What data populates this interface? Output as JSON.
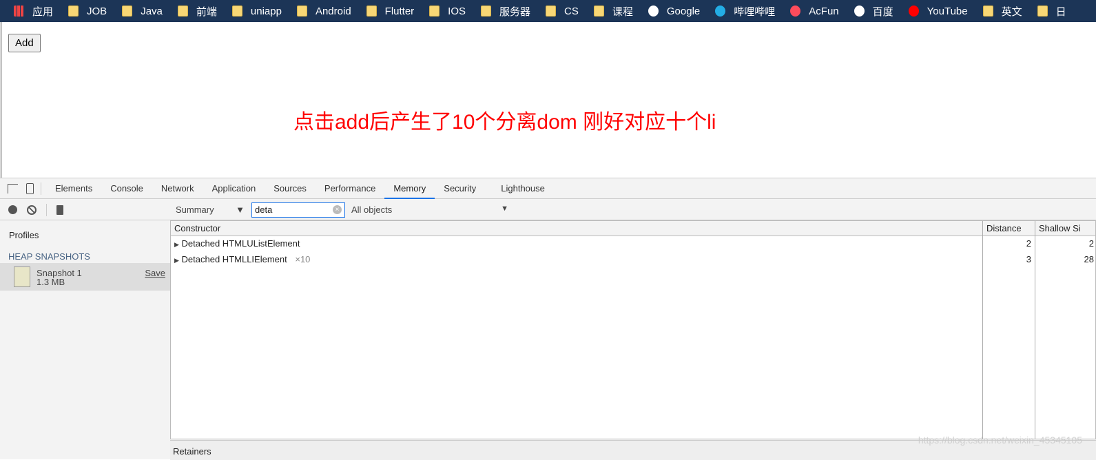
{
  "bookmarks": [
    {
      "label": "应用",
      "icon": "apps-grid-icon"
    },
    {
      "label": "JOB",
      "icon": "folder-icon"
    },
    {
      "label": "Java",
      "icon": "folder-icon"
    },
    {
      "label": "前端",
      "icon": "folder-icon"
    },
    {
      "label": "uniapp",
      "icon": "folder-icon"
    },
    {
      "label": "Android",
      "icon": "folder-icon"
    },
    {
      "label": "Flutter",
      "icon": "folder-icon"
    },
    {
      "label": "IOS",
      "icon": "folder-icon"
    },
    {
      "label": "服务器",
      "icon": "folder-icon"
    },
    {
      "label": "CS",
      "icon": "folder-icon"
    },
    {
      "label": "课程",
      "icon": "folder-icon"
    },
    {
      "label": "Google",
      "icon": "google-icon"
    },
    {
      "label": "哔哩哔哩",
      "icon": "bilibili-icon"
    },
    {
      "label": "AcFun",
      "icon": "acfun-icon"
    },
    {
      "label": "百度",
      "icon": "baidu-icon"
    },
    {
      "label": "YouTube",
      "icon": "youtube-icon"
    },
    {
      "label": "英文",
      "icon": "folder-icon"
    },
    {
      "label": "日",
      "icon": "folder-icon"
    }
  ],
  "page": {
    "add_button": "Add",
    "message": "点击add后产生了10个分离dom 刚好对应十个li"
  },
  "devtools": {
    "tabs": [
      "Elements",
      "Console",
      "Network",
      "Application",
      "Sources",
      "Performance",
      "Memory",
      "Security",
      "Lighthouse"
    ],
    "active_tab": "Memory",
    "sidebar": {
      "title": "Profiles",
      "section": "HEAP SNAPSHOTS",
      "snapshot_name": "Snapshot 1",
      "snapshot_size": "1.3 MB",
      "save": "Save"
    },
    "filter": {
      "view": "Summary",
      "search_value": "deta",
      "objects": "All objects"
    },
    "columns": {
      "constructor": "Constructor",
      "distance": "Distance",
      "shallow": "Shallow Si"
    },
    "rows": [
      {
        "name": "Detached HTMLUListElement",
        "count": "",
        "distance": "2",
        "shallow": "2"
      },
      {
        "name": "Detached HTMLLIElement",
        "count": "×10",
        "distance": "3",
        "shallow": "28"
      }
    ],
    "retainers": "Retainers"
  },
  "watermark": "https://blog.csdn.net/weixin_45345105",
  "colors": {
    "bookmark_bar": "#1c3557",
    "message": "#ff0000",
    "active_tab": "#1a73e8"
  }
}
